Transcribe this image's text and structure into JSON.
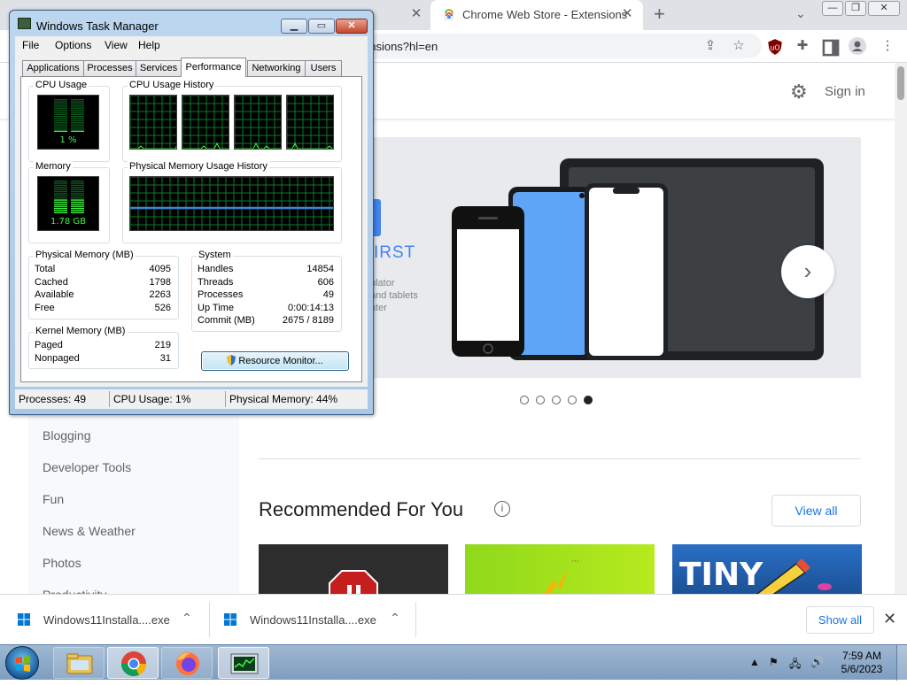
{
  "browser": {
    "tab_title": "Chrome Web Store - Extensions",
    "url": "ensions?hl=en",
    "tab_close": "✕",
    "new_tab": "+",
    "tab_search": "⌄",
    "win_min": "—",
    "win_max": "❐",
    "win_close": "✕",
    "toolbar_icons": [
      "share-icon",
      "star-icon",
      "ublock-icon",
      "puzzle-icon",
      "sidepanel-icon",
      "profile-icon",
      "menu-icon"
    ]
  },
  "store": {
    "sign_in": "Sign in",
    "categories": [
      "Blogging",
      "Developer Tools",
      "Fun",
      "News & Weather",
      "Photos",
      "Productivity"
    ],
    "banner_heading": "IRST",
    "banner_sub": "ulator\nand tablets\nuter",
    "carousel_next": "›",
    "carousel_dots": 5,
    "carousel_active_dot": 4,
    "recommended_title": "Recommended For You",
    "info_icon": "i",
    "view_all": "View all",
    "tile3_text": "TINY"
  },
  "downloads": {
    "items": [
      {
        "name": "Windows11Installa....exe"
      },
      {
        "name": "Windows11Installa....exe"
      }
    ],
    "show_all": "Show all",
    "close": "✕",
    "caret": "⌃"
  },
  "taskmgr": {
    "title": "Windows Task Manager",
    "min": "▁",
    "max": "▭",
    "close": "✕",
    "menu": [
      "File",
      "Options",
      "View",
      "Help"
    ],
    "tabs": [
      "Applications",
      "Processes",
      "Services",
      "Performance",
      "Networking",
      "Users"
    ],
    "active_tab": "Performance",
    "cpu_usage_label": "CPU Usage",
    "cpu_usage_value": "1 %",
    "cpu_usage_fraction": 0.01,
    "cpu_history_label": "CPU Usage History",
    "memory_label": "Memory",
    "memory_value": "1.78 GB",
    "memory_fraction": 0.44,
    "phys_history_label": "Physical Memory Usage History",
    "physical_memory": {
      "label": "Physical Memory (MB)",
      "rows": [
        {
          "k": "Total",
          "v": "4095"
        },
        {
          "k": "Cached",
          "v": "1798"
        },
        {
          "k": "Available",
          "v": "2263"
        },
        {
          "k": "Free",
          "v": "526"
        }
      ]
    },
    "system": {
      "label": "System",
      "rows": [
        {
          "k": "Handles",
          "v": "14854"
        },
        {
          "k": "Threads",
          "v": "606"
        },
        {
          "k": "Processes",
          "v": "49"
        },
        {
          "k": "Up Time",
          "v": "0:00:14:13"
        },
        {
          "k": "Commit (MB)",
          "v": "2675 / 8189"
        }
      ]
    },
    "kernel_memory": {
      "label": "Kernel Memory (MB)",
      "rows": [
        {
          "k": "Paged",
          "v": "219"
        },
        {
          "k": "Nonpaged",
          "v": "31"
        }
      ]
    },
    "resource_monitor": "Resource Monitor...",
    "status": {
      "processes": "Processes: 49",
      "cpu": "CPU Usage: 1%",
      "memory": "Physical Memory: 44%"
    }
  },
  "taskbar": {
    "time": "7:59 AM",
    "date": "5/6/2023",
    "tray_up": "▲",
    "tray_icons": [
      "action-center-icon",
      "network-icon",
      "volume-icon"
    ],
    "pinned": [
      "explorer-icon",
      "chrome-icon",
      "firefox-icon",
      "taskmgr-icon"
    ]
  },
  "colors": {
    "accent_blue": "#1a73e8",
    "graph_green": "#3df53d",
    "graph_grid": "#0d7a2c",
    "memory_line": "#4f7cff"
  }
}
